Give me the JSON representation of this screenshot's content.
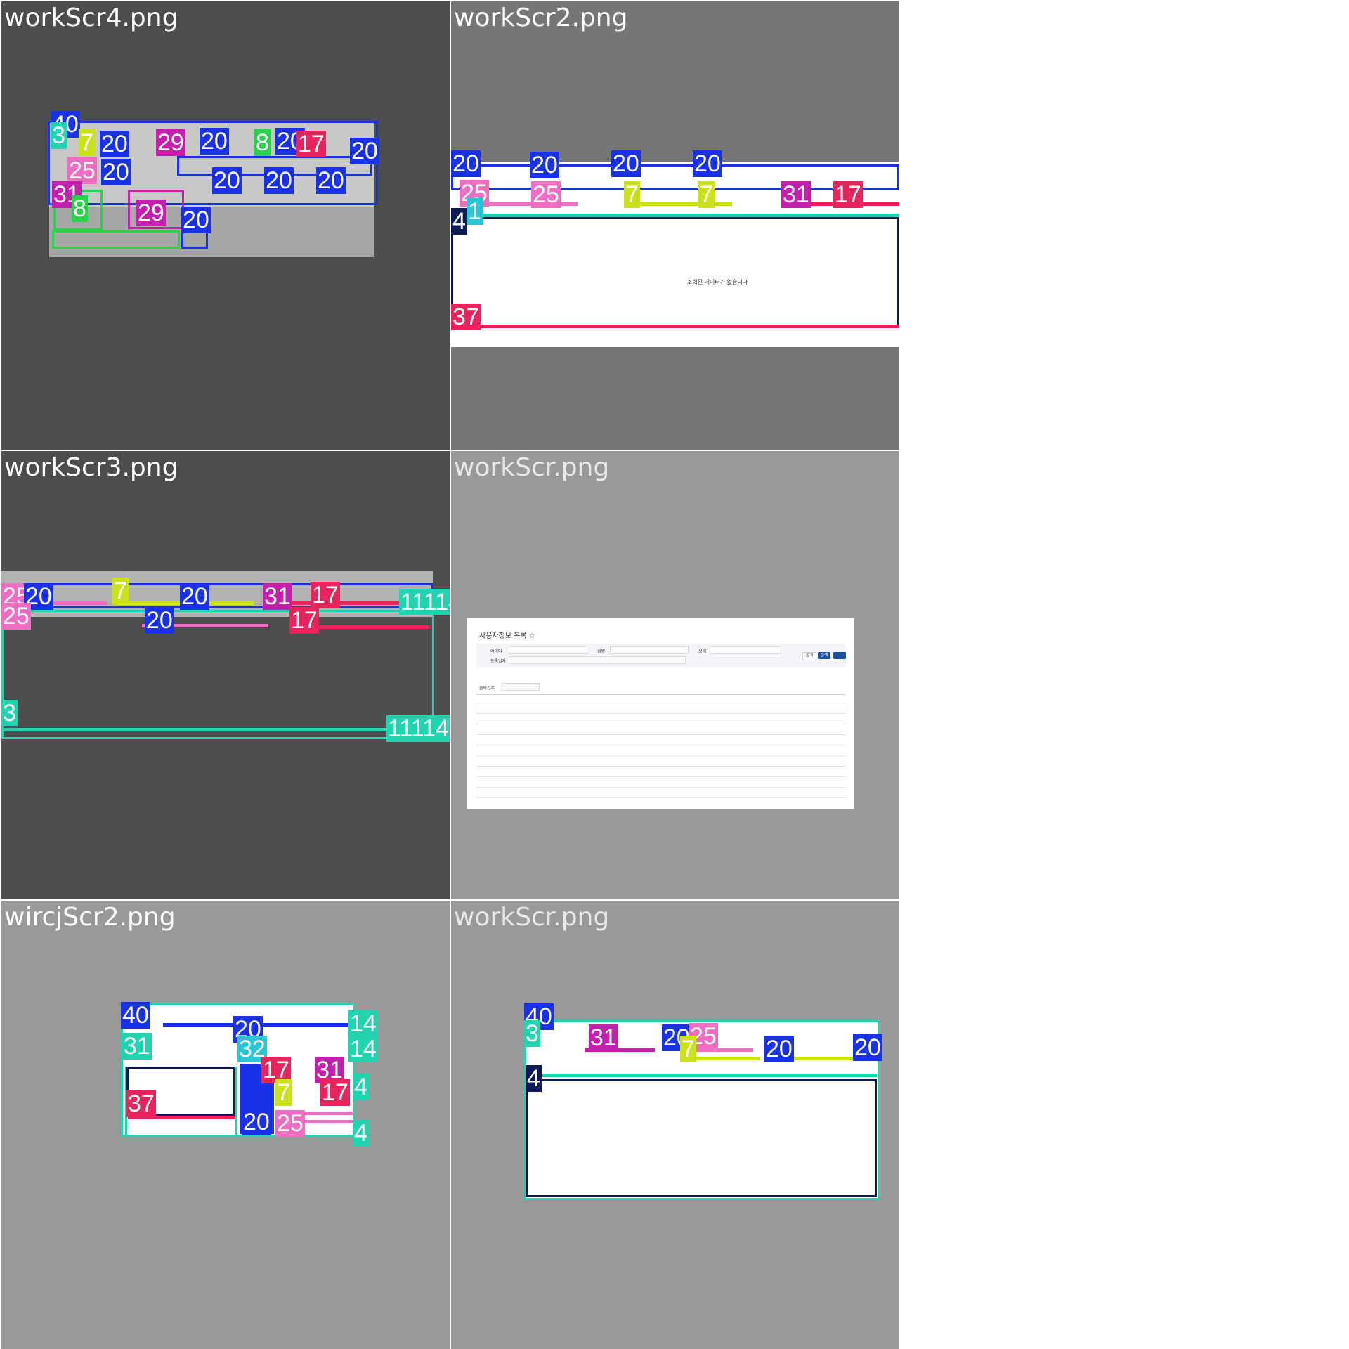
{
  "tiles": [
    {
      "filename": "workScr4.png"
    },
    {
      "filename": "workScr2.png"
    },
    {
      "filename": "workScr3.png"
    },
    {
      "filename": "workScr.png"
    },
    {
      "filename": "wircjScr2.png"
    },
    {
      "filename": "workScr.png"
    }
  ],
  "labels": {
    "l40": "40",
    "l3": "3",
    "l4": "4",
    "l7": "7",
    "l8": "8",
    "l14": "14",
    "l17": "17",
    "l20": "20",
    "l25": "25",
    "l29": "29",
    "l31": "31",
    "l32": "32",
    "l37": "37",
    "l1": "1",
    "l11114": "11114"
  },
  "screen": {
    "title": "사용자정보 목록 ☆",
    "field1": "아이디",
    "field2": "성명",
    "field3": "상태",
    "field4": "등록일자",
    "btn_search": "검색",
    "btn_reset": "초기",
    "page_size_label": "출력건수",
    "empty_text": "조회된 데이터가 없습니다"
  },
  "colors": {
    "blue": "#1a32e6",
    "teal": "#22d3b0",
    "magenta": "#c41fae",
    "pink": "#f06dc4",
    "lime": "#c9e21b",
    "red": "#e8245c",
    "navy": "#0d1a55",
    "green": "#2ad14a",
    "cyan": "#2ac6d6",
    "bg_dark": "#4d4d4d",
    "bg_mid": "#767676",
    "bg_light": "#999999"
  }
}
